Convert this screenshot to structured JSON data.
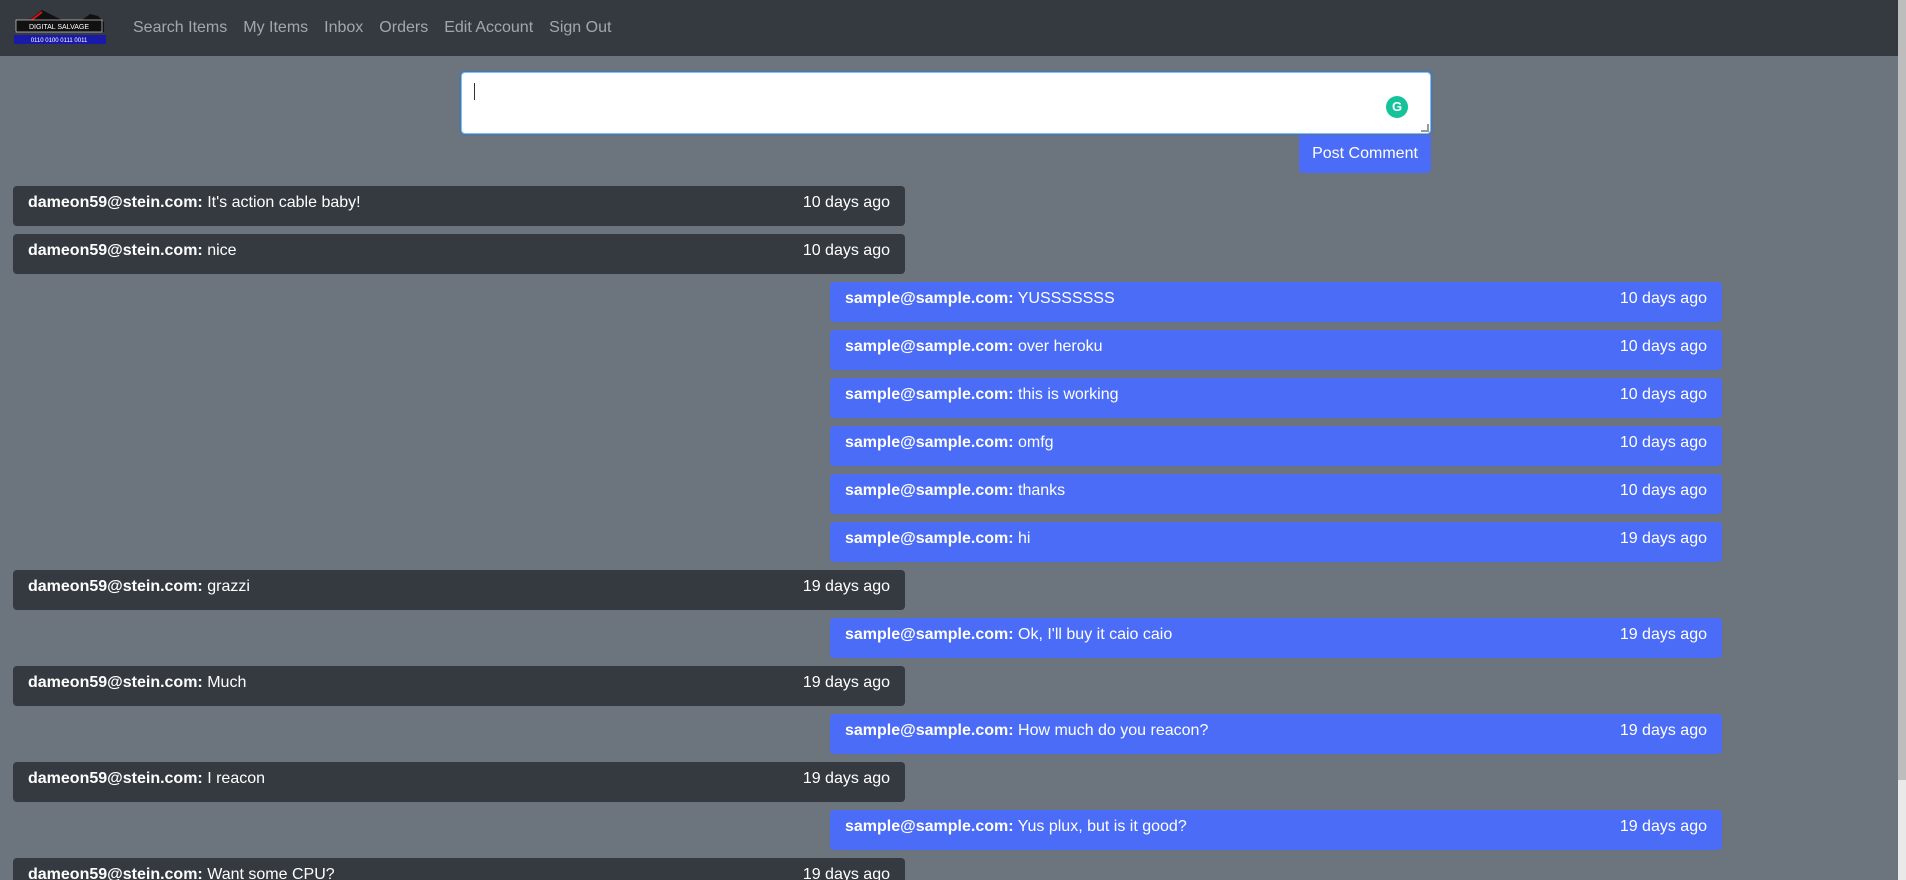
{
  "nav": {
    "logo_title": "DIGITAL SALVAGE",
    "logo_sub": "0110 0100 0111 0011",
    "links": [
      "Search Items",
      "My Items",
      "Inbox",
      "Orders",
      "Edit Account",
      "Sign Out"
    ]
  },
  "composer": {
    "placeholder": "",
    "value": "",
    "post_label": "Post Comment"
  },
  "colors": {
    "navbar": "#343a40",
    "background": "#6c757d",
    "mine": "#4a6cf7",
    "theirs": "#343a40"
  },
  "messages": [
    {
      "author": "dameon59@stein.com:",
      "text": " It's action cable baby!",
      "time": "10 days ago"
    },
    {
      "author": "dameon59@stein.com:",
      "text": " nice",
      "time": "10 days ago"
    },
    {
      "author": "sample@sample.com:",
      "text": " YUSSSSSSS",
      "time": "10 days ago"
    },
    {
      "author": "sample@sample.com:",
      "text": " over heroku",
      "time": "10 days ago"
    },
    {
      "author": "sample@sample.com:",
      "text": " this is working",
      "time": "10 days ago"
    },
    {
      "author": "sample@sample.com:",
      "text": " omfg",
      "time": "10 days ago"
    },
    {
      "author": "sample@sample.com:",
      "text": " thanks",
      "time": "10 days ago"
    },
    {
      "author": "sample@sample.com:",
      "text": " hi",
      "time": "19 days ago"
    },
    {
      "author": "dameon59@stein.com:",
      "text": " grazzi",
      "time": "19 days ago"
    },
    {
      "author": "sample@sample.com:",
      "text": " Ok, I'll buy it caio caio",
      "time": "19 days ago"
    },
    {
      "author": "dameon59@stein.com:",
      "text": " Much",
      "time": "19 days ago"
    },
    {
      "author": "sample@sample.com:",
      "text": " How much do you reacon?",
      "time": "19 days ago"
    },
    {
      "author": "dameon59@stein.com:",
      "text": " I reacon",
      "time": "19 days ago"
    },
    {
      "author": "sample@sample.com:",
      "text": " Yus plux, but is it good?",
      "time": "19 days ago"
    },
    {
      "author": "dameon59@stein.com:",
      "text": " Want some CPU?",
      "time": "19 days ago"
    }
  ]
}
